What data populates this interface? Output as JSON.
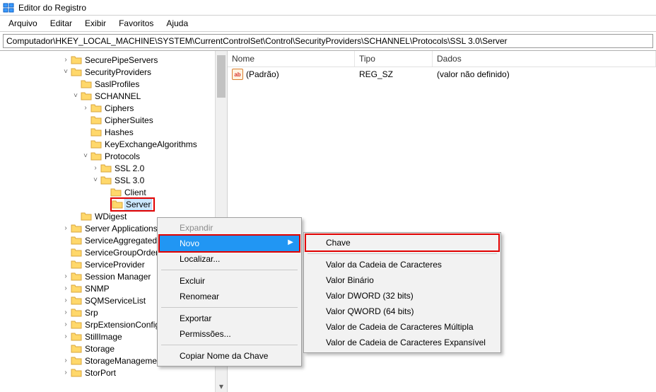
{
  "window": {
    "title": "Editor do Registro"
  },
  "menubar": [
    "Arquivo",
    "Editar",
    "Exibir",
    "Favoritos",
    "Ajuda"
  ],
  "address": "Computador\\HKEY_LOCAL_MACHINE\\SYSTEM\\CurrentControlSet\\Control\\SecurityProviders\\SCHANNEL\\Protocols\\SSL 3.0\\Server",
  "tree": {
    "rows": [
      {
        "depth": 4,
        "toggle": ">",
        "label": "SecurePipeServers"
      },
      {
        "depth": 4,
        "toggle": "v",
        "label": "SecurityProviders"
      },
      {
        "depth": 5,
        "toggle": "",
        "label": "SaslProfiles"
      },
      {
        "depth": 5,
        "toggle": "v",
        "label": "SCHANNEL"
      },
      {
        "depth": 6,
        "toggle": ">",
        "label": "Ciphers"
      },
      {
        "depth": 6,
        "toggle": "",
        "label": "CipherSuites"
      },
      {
        "depth": 6,
        "toggle": "",
        "label": "Hashes"
      },
      {
        "depth": 6,
        "toggle": "",
        "label": "KeyExchangeAlgorithms"
      },
      {
        "depth": 6,
        "toggle": "v",
        "label": "Protocols"
      },
      {
        "depth": 7,
        "toggle": ">",
        "label": "SSL 2.0"
      },
      {
        "depth": 7,
        "toggle": "v",
        "label": "SSL 3.0"
      },
      {
        "depth": 8,
        "toggle": "",
        "label": "Client"
      },
      {
        "depth": 8,
        "toggle": "",
        "label": "Server",
        "selected": true,
        "redbox": true
      },
      {
        "depth": 5,
        "toggle": "",
        "label": "WDigest"
      },
      {
        "depth": 4,
        "toggle": ">",
        "label": "Server Applications"
      },
      {
        "depth": 4,
        "toggle": "",
        "label": "ServiceAggregatedEvents"
      },
      {
        "depth": 4,
        "toggle": "",
        "label": "ServiceGroupOrder"
      },
      {
        "depth": 4,
        "toggle": "",
        "label": "ServiceProvider"
      },
      {
        "depth": 4,
        "toggle": ">",
        "label": "Session Manager"
      },
      {
        "depth": 4,
        "toggle": ">",
        "label": "SNMP"
      },
      {
        "depth": 4,
        "toggle": ">",
        "label": "SQMServiceList"
      },
      {
        "depth": 4,
        "toggle": ">",
        "label": "Srp"
      },
      {
        "depth": 4,
        "toggle": ">",
        "label": "SrpExtensionConfig"
      },
      {
        "depth": 4,
        "toggle": ">",
        "label": "StillImage"
      },
      {
        "depth": 4,
        "toggle": "",
        "label": "Storage"
      },
      {
        "depth": 4,
        "toggle": ">",
        "label": "StorageManagement"
      },
      {
        "depth": 4,
        "toggle": ">",
        "label": "StorPort"
      }
    ]
  },
  "list": {
    "headers": {
      "name": "Nome",
      "type": "Tipo",
      "data": "Dados"
    },
    "rows": [
      {
        "name": "(Padrão)",
        "type": "REG_SZ",
        "data": "(valor não definido)"
      }
    ]
  },
  "ctx1": {
    "items": [
      {
        "label": "Expandir",
        "disabled": true
      },
      {
        "label": "Novo",
        "highlight": true,
        "submenu": true,
        "redbox": true
      },
      {
        "label": "Localizar..."
      },
      {
        "divider": true
      },
      {
        "label": "Excluir"
      },
      {
        "label": "Renomear"
      },
      {
        "divider": true
      },
      {
        "label": "Exportar"
      },
      {
        "label": "Permissões..."
      },
      {
        "divider": true
      },
      {
        "label": "Copiar Nome da Chave"
      }
    ]
  },
  "ctx2": {
    "items": [
      {
        "label": "Chave",
        "redbox": true
      },
      {
        "divider": true
      },
      {
        "label": "Valor da Cadeia de Caracteres"
      },
      {
        "label": "Valor Binário"
      },
      {
        "label": "Valor DWORD (32 bits)"
      },
      {
        "label": "Valor QWORD (64 bits)"
      },
      {
        "label": "Valor de Cadeia de Caracteres Múltipla"
      },
      {
        "label": "Valor de Cadeia de Caracteres Expansível"
      }
    ]
  }
}
